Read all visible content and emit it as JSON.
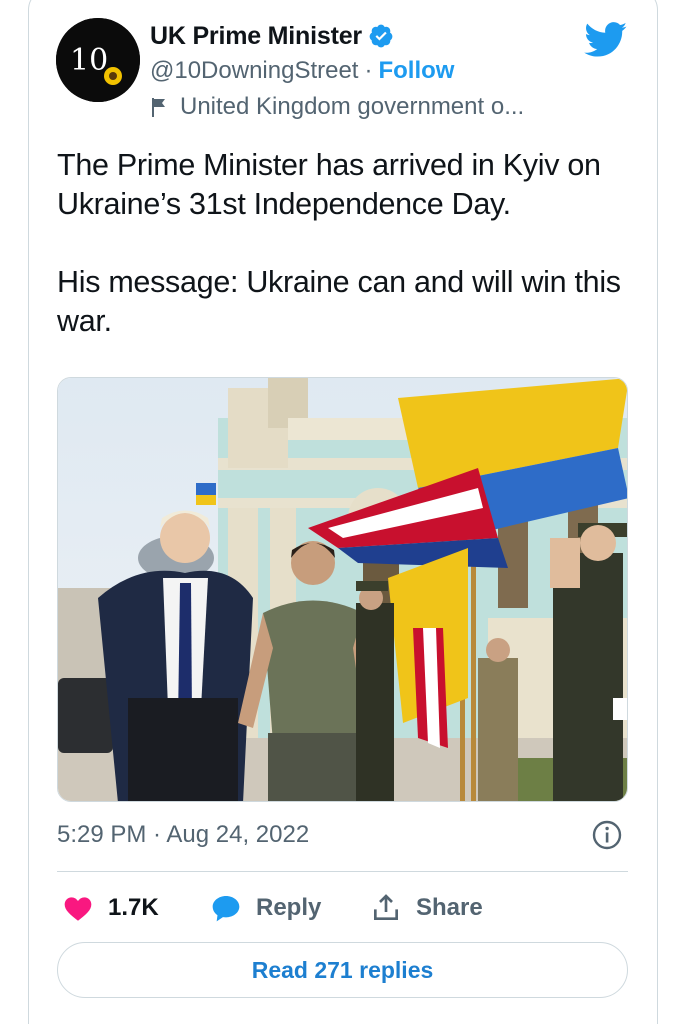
{
  "account": {
    "display_name": "UK Prime Minister",
    "handle": "@10DowningStreet",
    "separator": "·",
    "follow_label": "Follow",
    "affiliation_label": "United Kingdom government o...",
    "avatar_text": "10",
    "verified": true
  },
  "tweet": {
    "paragraphs": [
      "The Prime Minister has arrived in Kyiv on Ukraine’s 31st Independence Day.",
      "His message: Ukraine can and will win this war."
    ],
    "timestamp": "5:29 PM · Aug 24, 2022"
  },
  "actions": {
    "likes_count": "1.7K",
    "reply_label": "Reply",
    "share_label": "Share"
  },
  "replies_button": {
    "label": "Read 271 replies"
  },
  "icons": {
    "platform": "twitter-bird-icon",
    "verified": "verified-badge-icon",
    "affiliation": "flag-icon",
    "info": "info-icon",
    "like": "heart-icon",
    "reply": "speech-bubble-icon",
    "share": "share-icon"
  },
  "colors": {
    "accent": "#1d9bf0",
    "like": "#f91880",
    "text": "#0f1419",
    "secondary": "#536471",
    "border": "#cfd9de"
  }
}
